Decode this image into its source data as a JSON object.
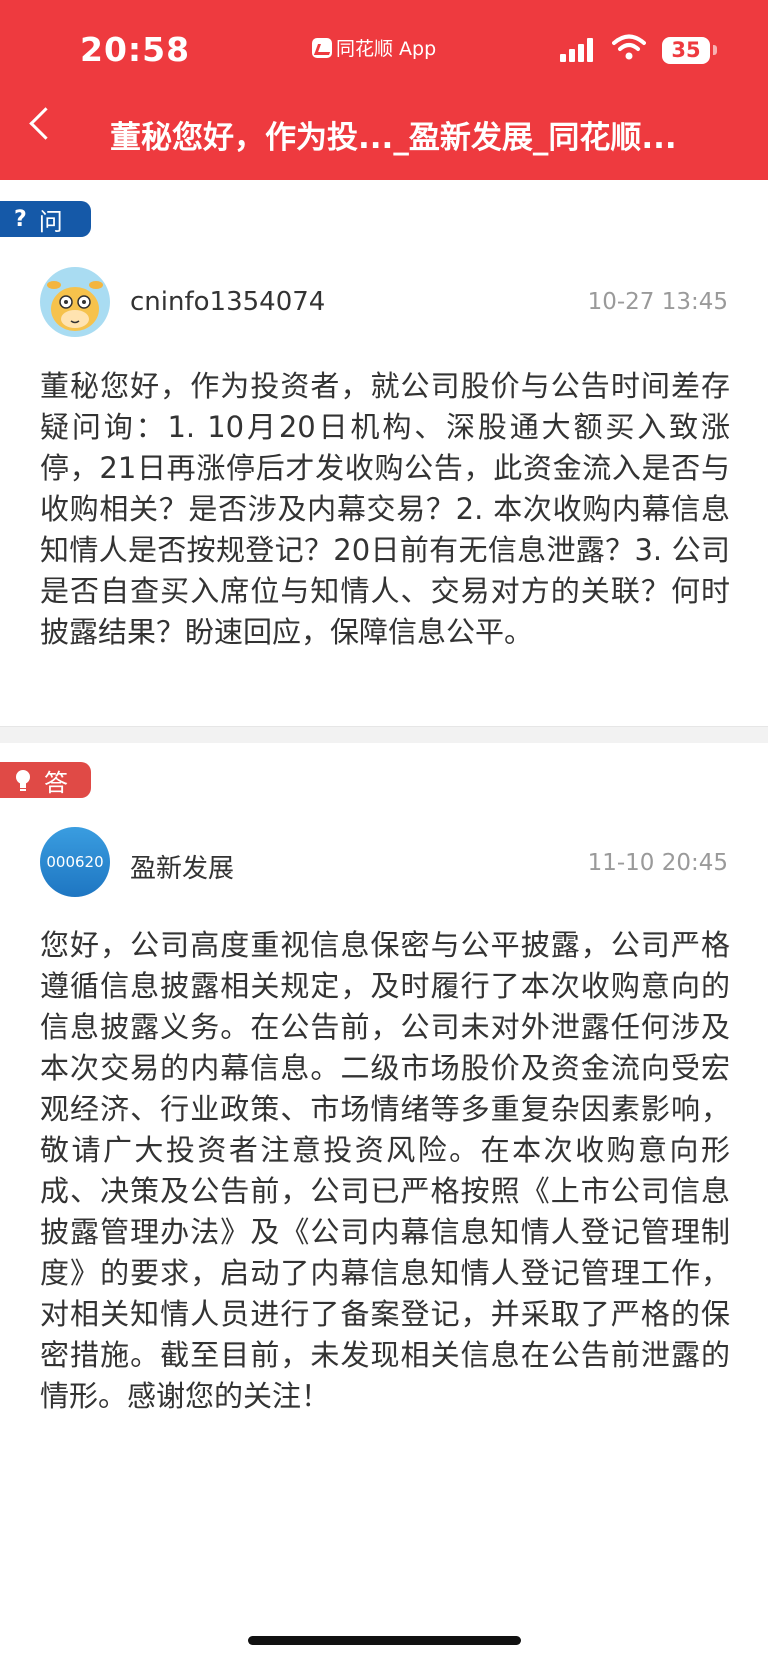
{
  "status_bar": {
    "time": "20:58",
    "app_label": "同花顺 App",
    "battery": "35"
  },
  "header": {
    "title": "董秘您好，作为投..._盈新发展_同花顺...",
    "back_icon": "chevron-left-icon",
    "background_color": "#ee3a3f"
  },
  "question": {
    "tag_label": "问",
    "tag_color": "#1559a8",
    "user_name": "cninfo1354074",
    "date": "10-27 13:45",
    "text": "董秘您好，作为投资者，就公司股价与公告时间差存疑问询：1. 10月20日机构、深股通大额买入致涨停，21日再涨停后才发收购公告，此资金流入是否与收购相关？是否涉及内幕交易？2. 本次收购内幕信息知情人是否按规登记？20日前有无信息泄露？3. 公司是否自查买入席位与知情人、交易对方的关联？何时披露结果？盼速回应，保障信息公平。"
  },
  "answer": {
    "tag_label": "答",
    "tag_color": "#e04a46",
    "company_code": "000620",
    "company_name": "盈新发展",
    "date": "11-10 20:45",
    "text": "您好，公司高度重视信息保密与公平披露，公司严格遵循信息披露相关规定，及时履行了本次收购意向的信息披露义务。在公告前，公司未对外泄露任何涉及本次交易的内幕信息。二级市场股价及资金流向受宏观经济、行业政策、市场情绪等多重复杂因素影响，敬请广大投资者注意投资风险。在本次收购意向形成、决策及公告前，公司已严格按照《上市公司信息披露管理办法》及《公司内幕信息知情人登记管理制度》的要求，启动了内幕信息知情人登记管理工作，对相关知情人员进行了备案登记，并采取了严格的保密措施。截至目前，未发现相关信息在公告前泄露的情形。感谢您的关注！"
  }
}
